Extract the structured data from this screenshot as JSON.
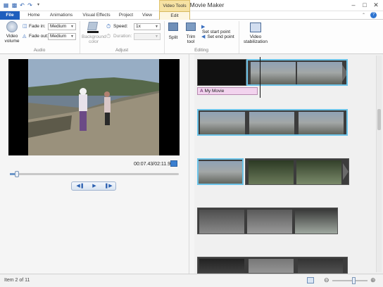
{
  "window": {
    "title": "My Movie - Movie Maker",
    "context_tab": "Video Tools"
  },
  "ribbon_tabs": [
    "File",
    "Home",
    "Animations",
    "Visual Effects",
    "Project",
    "View",
    "Edit"
  ],
  "ribbon": {
    "video_volume": "Video volume",
    "fade_in_label": "Fade in:",
    "fade_in_value": "Medium",
    "fade_out_label": "Fade out:",
    "fade_out_value": "Medium",
    "background_color": "Background color",
    "speed_label": "Speed:",
    "speed_value": "1x",
    "duration_label": "Duration:",
    "duration_value": "",
    "split": "Split",
    "trim_tool": "Trim tool",
    "set_start": "Set start point",
    "set_end": "Set end point",
    "video_stabilization": "Video stabilization",
    "groups": {
      "audio": "Audio",
      "adjust": "Adjust",
      "editing": "Editing"
    }
  },
  "preview": {
    "timecode": "00:07.43/02:11.96",
    "seek_progress": 0.04
  },
  "storyboard": {
    "caption": "My Movie"
  },
  "status": {
    "item": "Item 2 of 11",
    "zoom_level": 0.62
  },
  "colors": {
    "file_tab": "#1e5ebd",
    "selection": "#6cc3e8",
    "caption_bg": "#f2d3ee"
  }
}
